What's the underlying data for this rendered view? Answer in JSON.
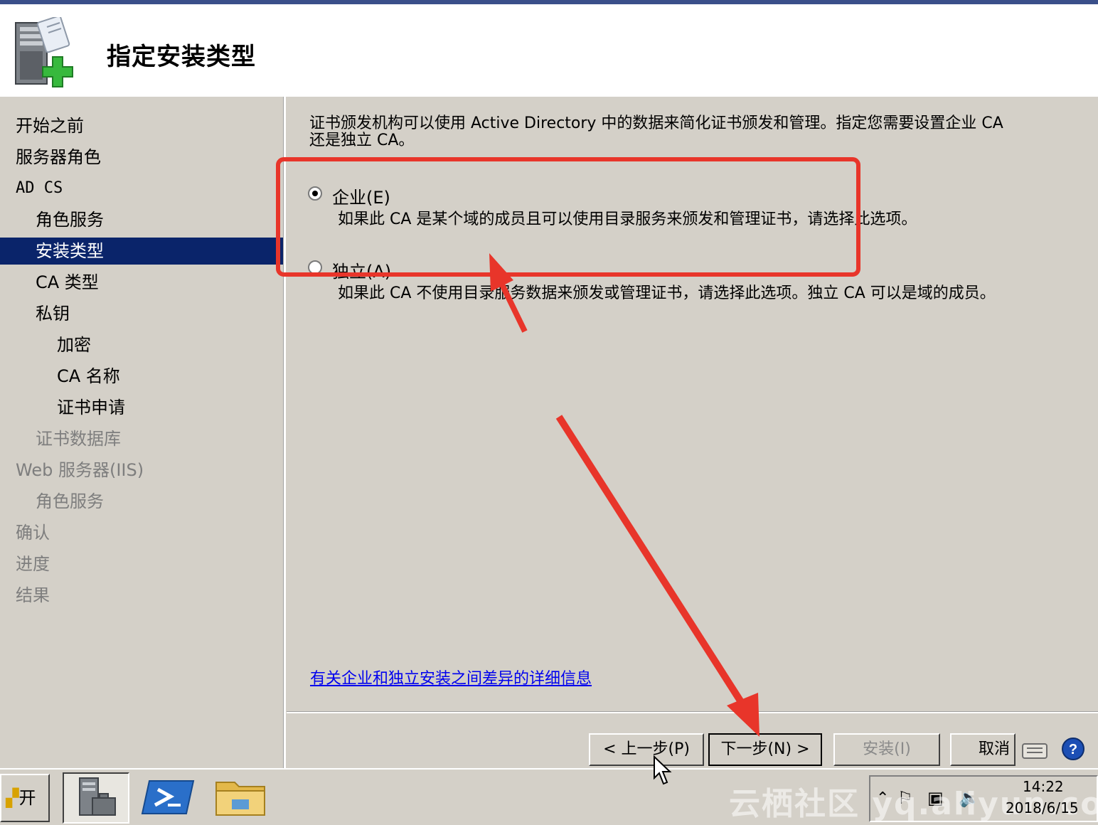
{
  "header": {
    "title": "指定安装类型"
  },
  "sidebar": {
    "items": [
      {
        "label": "开始之前",
        "state": "normal"
      },
      {
        "label": "服务器角色",
        "state": "normal"
      },
      {
        "label": "AD CS",
        "state": "normal"
      },
      {
        "label": "角色服务",
        "state": "normal"
      },
      {
        "label": "安装类型",
        "state": "active"
      },
      {
        "label": "CA 类型",
        "state": "normal"
      },
      {
        "label": "私钥",
        "state": "normal"
      },
      {
        "label": "加密",
        "state": "normal"
      },
      {
        "label": "CA 名称",
        "state": "normal"
      },
      {
        "label": "证书申请",
        "state": "normal"
      },
      {
        "label": "证书数据库",
        "state": "disabled"
      },
      {
        "label": "Web 服务器(IIS)",
        "state": "disabled"
      },
      {
        "label": "角色服务",
        "state": "disabled"
      },
      {
        "label": "确认",
        "state": "disabled"
      },
      {
        "label": "进度",
        "state": "disabled"
      },
      {
        "label": "结果",
        "state": "disabled"
      }
    ]
  },
  "main": {
    "intro_line1": "证书颁发机构可以使用 Active Directory 中的数据来简化证书颁发和管理。指定您需要设置企业 CA",
    "intro_line2": "还是独立 CA。",
    "options": [
      {
        "label": "企业(E)",
        "description": "如果此 CA 是某个域的成员且可以使用目录服务来颁发和管理证书，请选择此选项。",
        "selected": true
      },
      {
        "label": "独立(A)",
        "description": "如果此 CA 不使用目录服务数据来颁发或管理证书，请选择此选项。独立 CA 可以是域的成员。",
        "selected": false
      }
    ],
    "info_link": "有关企业和独立安装之间差异的详细信息"
  },
  "buttons": {
    "prev": "< 上一步(P)",
    "next": "下一步(N) >",
    "install": "安装(I)",
    "cancel": "取消"
  },
  "taskbar": {
    "start_label": "开始",
    "clock_time": "14:22",
    "clock_date": "2018/6/15",
    "watermark": "云栖社区 yq.aliyun.com"
  },
  "colors": {
    "selection": "#0a246a",
    "annotation": "#e8352a",
    "link": "#0000ee"
  }
}
